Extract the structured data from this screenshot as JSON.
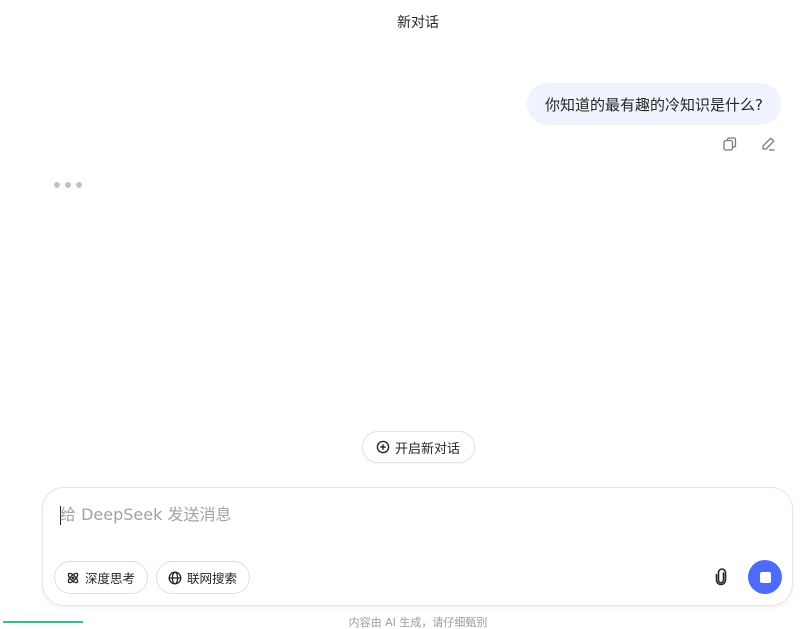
{
  "header": {
    "title": "新对话"
  },
  "conversation": {
    "user_message": "你知道的最有趣的冷知识是什么?",
    "actions": {
      "copy_icon": "copy-icon",
      "edit_icon": "pencil-icon"
    },
    "assistant_state": "typing"
  },
  "new_chat_button": {
    "label": "开启新对话",
    "icon": "plus-circle-icon"
  },
  "composer": {
    "placeholder": "给 DeepSeek 发送消息",
    "value": "",
    "deep_think_label": "深度思考",
    "web_search_label": "联网搜索",
    "attach_icon": "paperclip-icon",
    "send_state": "stop"
  },
  "footer": {
    "disclaimer": "内容由 AI 生成，请仔细甄别"
  },
  "colors": {
    "accent": "#4d6bfe",
    "user_bubble": "#eef3fe",
    "bottom_bar": "#3db89d"
  }
}
